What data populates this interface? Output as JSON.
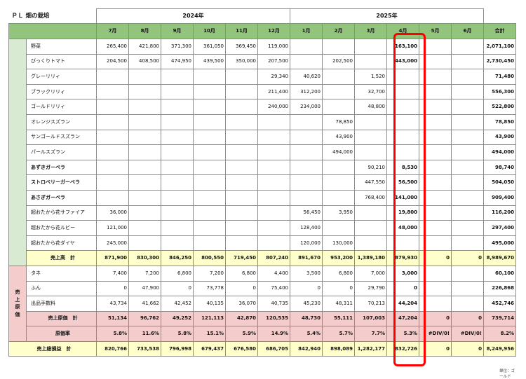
{
  "title": "ＰＬ 畑の栽培",
  "years": {
    "y2024": "2024年",
    "y2025": "2025年"
  },
  "months": [
    "7月",
    "8月",
    "9月",
    "10月",
    "11月",
    "12月",
    "1月",
    "2月",
    "3月",
    "4月",
    "5月",
    "6月"
  ],
  "total_header": "合計",
  "groups": {
    "sales": {
      "label_lines": []
    },
    "cost": {
      "label_lines": [
        "売",
        "上",
        "原",
        "価"
      ]
    }
  },
  "sales_rows": [
    {
      "label": "野菜",
      "bold": false,
      "values": [
        "265,400",
        "421,800",
        "371,300",
        "361,050",
        "369,450",
        "119,000",
        "",
        "",
        "",
        "163,100",
        "",
        ""
      ],
      "total": "2,071,100"
    },
    {
      "label": "びっくりトマト",
      "bold": false,
      "values": [
        "204,500",
        "408,500",
        "474,950",
        "439,500",
        "350,000",
        "207,500",
        "",
        "202,500",
        "",
        "443,000",
        "",
        ""
      ],
      "total": "2,730,450"
    },
    {
      "label": "グレーリリィ",
      "bold": false,
      "values": [
        "",
        "",
        "",
        "",
        "",
        "29,340",
        "40,620",
        "",
        "1,520",
        "",
        "",
        ""
      ],
      "total": "71,480"
    },
    {
      "label": "ブラックリリィ",
      "bold": false,
      "values": [
        "",
        "",
        "",
        "",
        "",
        "211,400",
        "312,200",
        "",
        "32,700",
        "",
        "",
        ""
      ],
      "total": "556,300"
    },
    {
      "label": "ゴールドリリィ",
      "bold": false,
      "values": [
        "",
        "",
        "",
        "",
        "",
        "240,000",
        "234,000",
        "",
        "48,800",
        "",
        "",
        ""
      ],
      "total": "522,800"
    },
    {
      "label": "オレンジスズラン",
      "bold": false,
      "values": [
        "",
        "",
        "",
        "",
        "",
        "",
        "",
        "78,850",
        "",
        "",
        "",
        ""
      ],
      "total": "78,850"
    },
    {
      "label": "サンゴールドスズラン",
      "bold": false,
      "values": [
        "",
        "",
        "",
        "",
        "",
        "",
        "",
        "43,900",
        "",
        "",
        "",
        ""
      ],
      "total": "43,900"
    },
    {
      "label": "パールスズラン",
      "bold": false,
      "values": [
        "",
        "",
        "",
        "",
        "",
        "",
        "",
        "494,000",
        "",
        "",
        "",
        ""
      ],
      "total": "494,000"
    },
    {
      "label": "あずきガーベラ",
      "bold": true,
      "values": [
        "",
        "",
        "",
        "",
        "",
        "",
        "",
        "",
        "90,210",
        "8,530",
        "",
        ""
      ],
      "total": "98,740"
    },
    {
      "label": "ストロベリーガーベラ",
      "bold": true,
      "values": [
        "",
        "",
        "",
        "",
        "",
        "",
        "",
        "",
        "447,550",
        "56,500",
        "",
        ""
      ],
      "total": "504,050"
    },
    {
      "label": "あさぎガーベラ",
      "bold": true,
      "values": [
        "",
        "",
        "",
        "",
        "",
        "",
        "",
        "",
        "768,400",
        "141,000",
        "",
        ""
      ],
      "total": "909,400"
    },
    {
      "label": "超おたから花サファイア",
      "bold": false,
      "values": [
        "36,000",
        "",
        "",
        "",
        "",
        "",
        "56,450",
        "3,950",
        "",
        "19,800",
        "",
        ""
      ],
      "total": "116,200"
    },
    {
      "label": "超おたから花ルビー",
      "bold": false,
      "values": [
        "121,000",
        "",
        "",
        "",
        "",
        "",
        "128,400",
        "",
        "",
        "48,000",
        "",
        ""
      ],
      "total": "297,400"
    },
    {
      "label": "超おたから花ダイヤ",
      "bold": false,
      "values": [
        "245,000",
        "",
        "",
        "",
        "",
        "",
        "120,000",
        "130,000",
        "",
        "",
        "",
        ""
      ],
      "total": "495,000"
    }
  ],
  "sales_total": {
    "label": "売上高　計",
    "values": [
      "871,900",
      "830,300",
      "846,250",
      "800,550",
      "719,450",
      "807,240",
      "891,670",
      "953,200",
      "1,389,180",
      "879,930",
      "0",
      "0"
    ],
    "total": "8,989,670"
  },
  "cost_rows": [
    {
      "label": "タネ",
      "values": [
        "7,400",
        "7,200",
        "6,800",
        "7,200",
        "6,800",
        "4,400",
        "3,500",
        "6,800",
        "7,000",
        "3,000",
        "",
        ""
      ],
      "total": "60,100"
    },
    {
      "label": "ふん",
      "values": [
        "0",
        "47,900",
        "0",
        "73,778",
        "0",
        "75,400",
        "0",
        "0",
        "29,790",
        "0",
        "",
        ""
      ],
      "total": "226,868"
    },
    {
      "label": "出品手数料",
      "values": [
        "43,734",
        "41,662",
        "42,452",
        "40,135",
        "36,070",
        "40,735",
        "45,230",
        "48,311",
        "70,213",
        "44,204",
        "",
        ""
      ],
      "total": "452,746"
    }
  ],
  "cost_total": {
    "label": "売上原価　計",
    "values": [
      "51,134",
      "96,762",
      "49,252",
      "121,113",
      "42,870",
      "120,535",
      "48,730",
      "55,111",
      "107,003",
      "47,204",
      "0",
      "0"
    ],
    "total": "739,714"
  },
  "cost_ratio": {
    "label": "原価率",
    "values": [
      "5.8%",
      "11.6%",
      "5.8%",
      "15.1%",
      "5.9%",
      "14.9%",
      "5.4%",
      "5.7%",
      "7.7%",
      "5.3%",
      "#DIV/0!",
      "#DIV/0!"
    ],
    "total": "8.2%"
  },
  "gross_profit": {
    "label": "売上総損益　計",
    "values": [
      "820,766",
      "733,538",
      "796,998",
      "679,437",
      "676,580",
      "686,705",
      "842,940",
      "898,089",
      "1,282,177",
      "832,726",
      "0",
      "0"
    ],
    "total": "8,249,956"
  },
  "footnote": "単位：ゴールド",
  "colors": {
    "header_green": "#93c47d",
    "sales_green": "#d9ead3",
    "cost_pink": "#f4cccc",
    "sum_yellow": "#ffffcc",
    "highlight_red": "#ff0000"
  }
}
